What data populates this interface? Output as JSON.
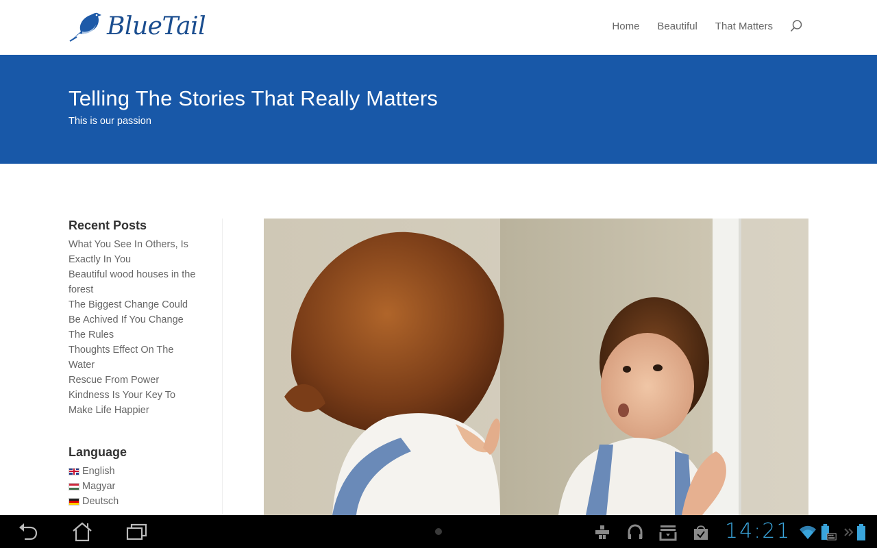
{
  "site": {
    "brand": "BlueTail",
    "brand_color": "#1a4d8f",
    "nav": [
      {
        "label": "Home"
      },
      {
        "label": "Beautiful"
      },
      {
        "label": "That Matters"
      }
    ],
    "search_icon": "search-icon"
  },
  "hero": {
    "title": "Telling The Stories That Really Matters",
    "subtitle": "This is our passion",
    "background_color": "#1858a8"
  },
  "sidebar": {
    "recent_posts": {
      "title": "Recent Posts",
      "items": [
        {
          "label": "What You See In Others, Is Exactly In You"
        },
        {
          "label": "Beautiful wood houses in the forest"
        },
        {
          "label": "The Biggest Change Could Be Achived If You Change The Rules"
        },
        {
          "label": "Thoughts Effect On The Water"
        },
        {
          "label": "Rescue From Power"
        },
        {
          "label": "Kindness Is Your Key To Make Life Happier"
        }
      ]
    },
    "language": {
      "title": "Language",
      "items": [
        {
          "label": "English",
          "flag": "uk-flag-icon"
        },
        {
          "label": "Magyar",
          "flag": "hungary-flag-icon"
        },
        {
          "label": "Deutsch",
          "flag": "germany-flag-icon"
        }
      ]
    }
  },
  "featured_image": {
    "description": "Toddler looking at reflection in a mirror"
  },
  "system_bar": {
    "clock": "14:21",
    "clock_color": "#3aa5dc",
    "buttons": [
      "back-icon",
      "home-icon",
      "recent-apps-icon"
    ],
    "status_icons": [
      "usb-debug-icon",
      "headset-icon",
      "download-icon",
      "market-update-icon",
      "wifi-icon",
      "battery-keyboard-icon",
      "chevron-icon",
      "battery-icon"
    ]
  }
}
